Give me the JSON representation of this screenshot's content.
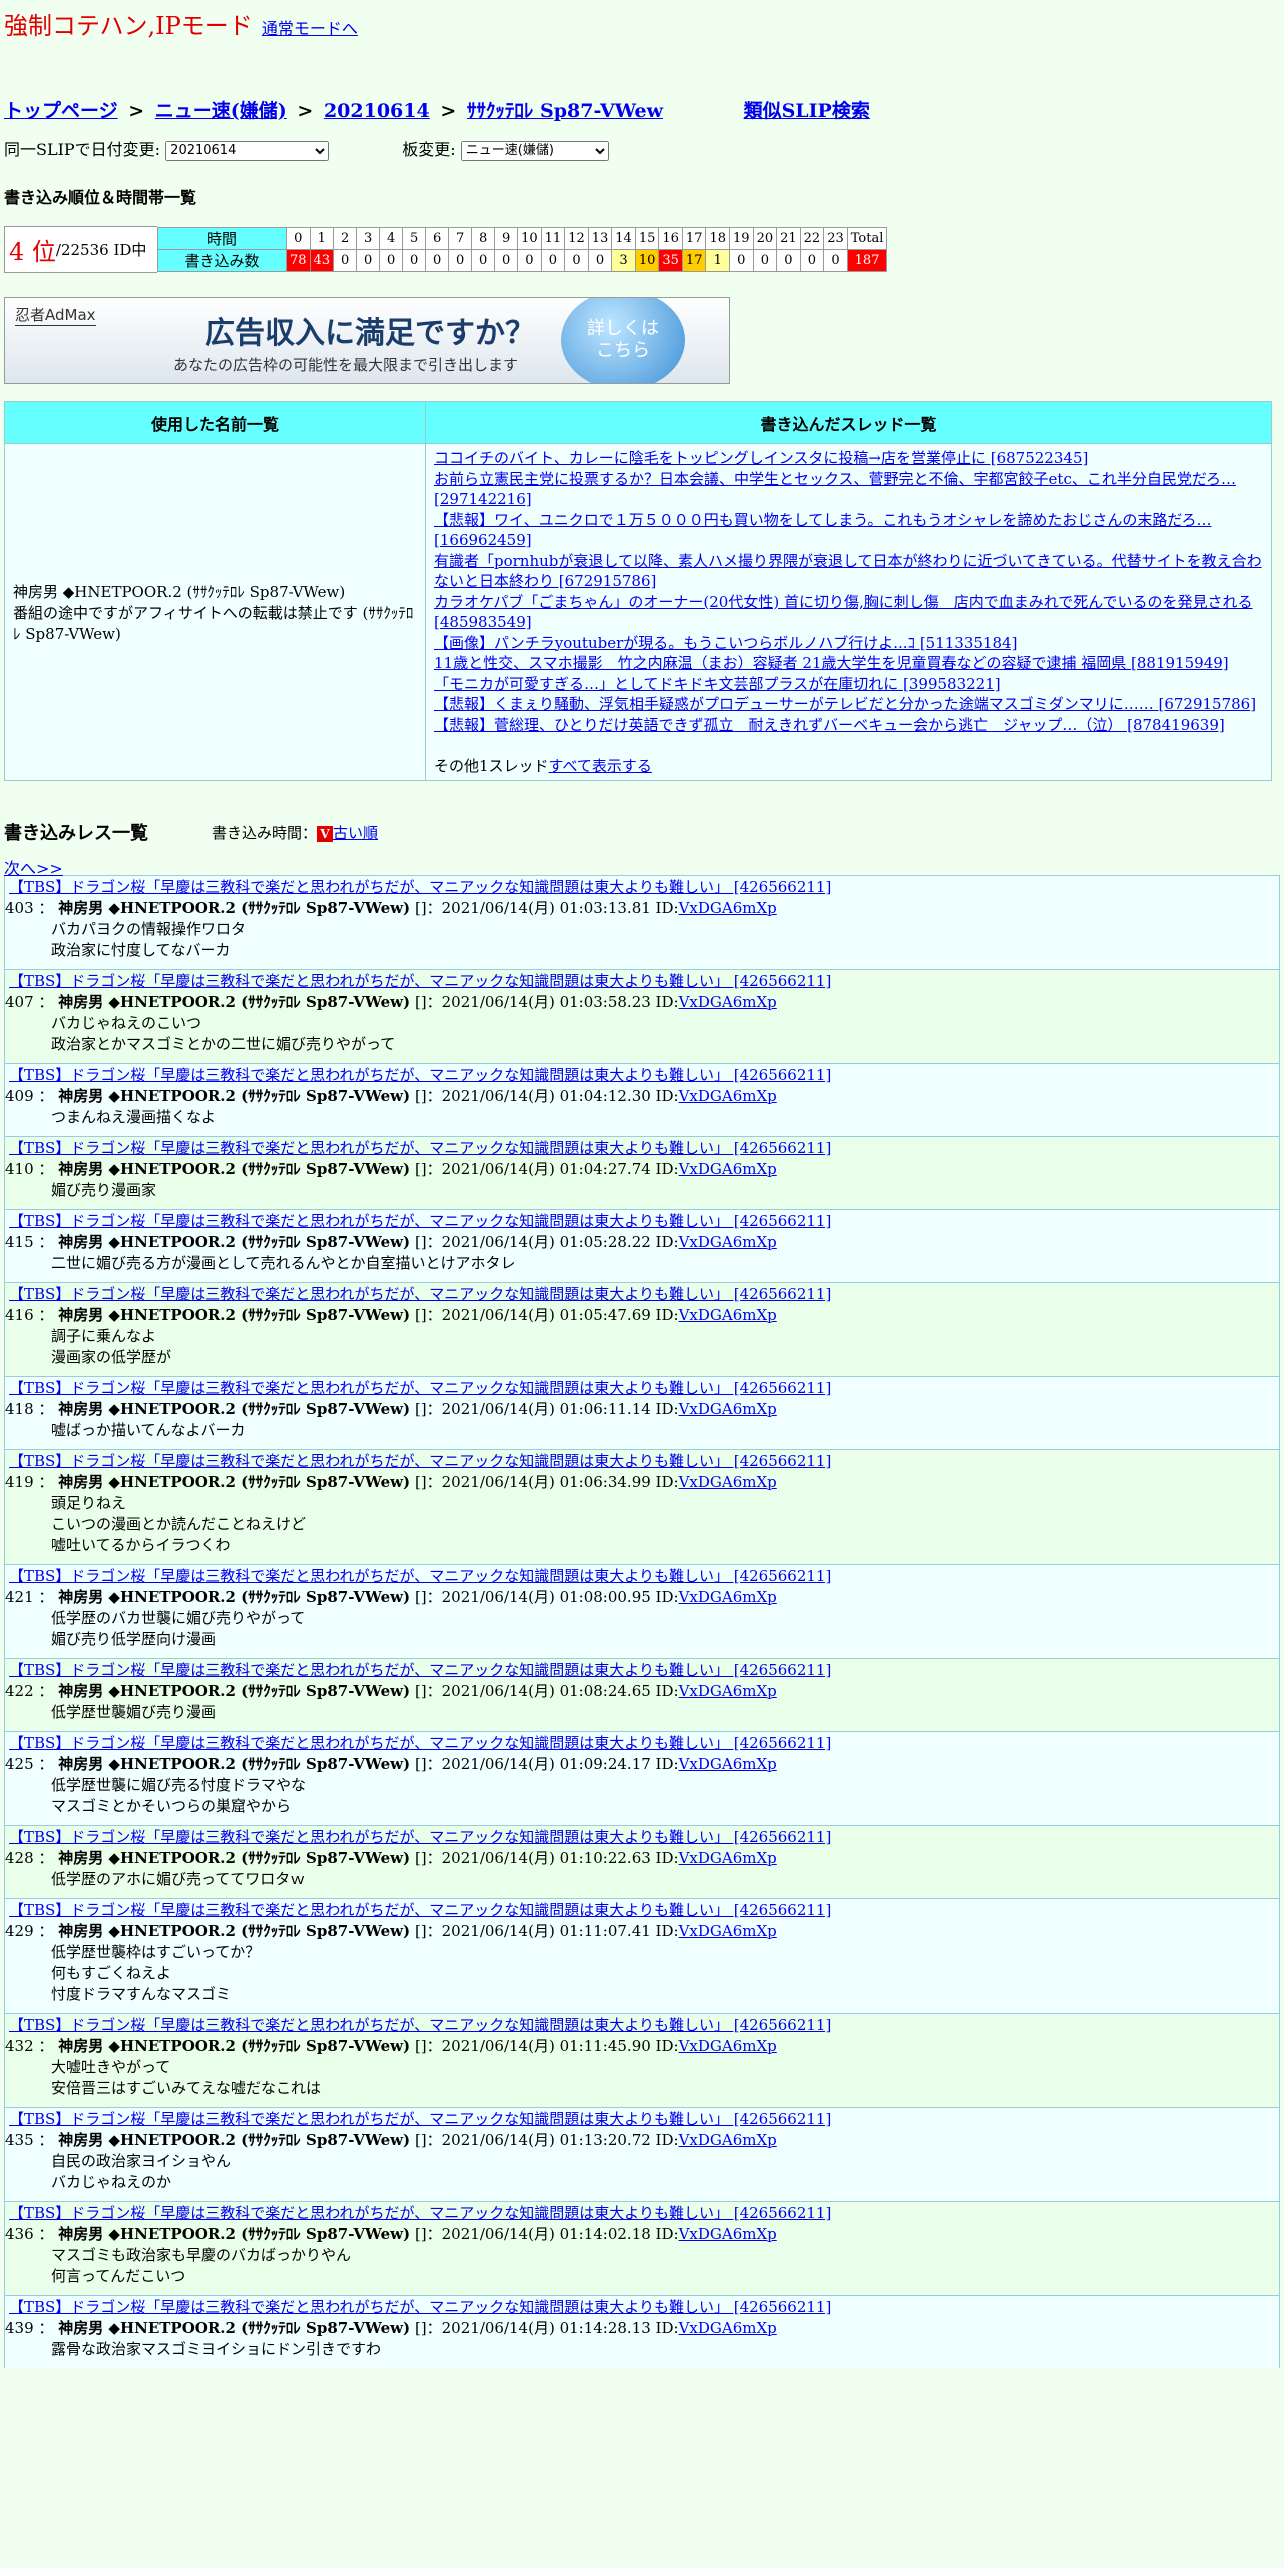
{
  "mode": {
    "title": "強制コテハン,IPモード",
    "link": "通常モードへ"
  },
  "breadcrumb": {
    "items": [
      "トップページ",
      "ニュー速(嫌儲)",
      "20210614",
      "ｻｻｸｯﾃﾛﾚ Sp87-VWew"
    ],
    "separator": ">",
    "similar": "類似SLIP検索"
  },
  "selects": {
    "date_label": "同一SLIPで日付変更:",
    "date_value": "20210614",
    "board_label": "板変更:",
    "board_value": "ニュー速(嫌儲)"
  },
  "rank": {
    "heading": "書き込み順位＆時間帯一覧",
    "position": "4 位",
    "of": "/22536 ID中",
    "time_label": "時間",
    "count_label": "書き込み数",
    "hours": [
      "0",
      "1",
      "2",
      "3",
      "4",
      "5",
      "6",
      "7",
      "8",
      "9",
      "10",
      "11",
      "12",
      "13",
      "14",
      "15",
      "16",
      "17",
      "18",
      "19",
      "20",
      "21",
      "22",
      "23",
      "Total"
    ],
    "counts": [
      "0",
      "78",
      "43",
      "0",
      "0",
      "0",
      "0",
      "0",
      "0",
      "0",
      "0",
      "0",
      "0",
      "0",
      "0",
      "3",
      "10",
      "35",
      "17",
      "1",
      "0",
      "0",
      "0",
      "0",
      "0",
      "187"
    ],
    "count_colors": [
      "",
      "red",
      "red",
      "",
      "",
      "",
      "",
      "",
      "",
      "",
      "",
      "",
      "",
      "",
      "",
      "lightyellow",
      "yellow",
      "red",
      "yellow",
      "lightyellow",
      "",
      "",
      "",
      "",
      "",
      "red"
    ]
  },
  "ad": {
    "brand": "忍者AdMax",
    "headline": "広告収入に満足ですか？",
    "sub": "あなたの広告枠の可能性を最大限まで引き出します",
    "button": "詳しくは\nこちら"
  },
  "names_table": {
    "col1": "使用した名前一覧",
    "col2": "書き込んだスレッド一覧",
    "names": [
      "神房男 ◆HNETPOOR.2 (ｻｻｸｯﾃﾛﾚ Sp87-VWew)",
      "番組の途中ですがアフィサイトへの転載は禁止です (ｻｻｸｯﾃﾛﾚ Sp87-VWew)"
    ],
    "threads": [
      "ココイチのバイト、カレーに陰毛をトッピングしインスタに投稿→店を営業停止に [687522345]",
      "お前ら立憲民主党に投票するか？日本会議、中学生とセックス、菅野完と不倫、宇都宮餃子etc、これ半分自民党だろ… [297142216]",
      "【悲報】ワイ、ユニクロで１万５０００円も買い物をしてしまう。これもうオシャレを諦めたおじさんの末路だろ… [166962459]",
      "有識者「pornhubが衰退して以降、素人ハメ撮り界隈が衰退して日本が終わりに近づいてきている。代替サイトを教え合わないと日本終わり [672915786]",
      "カラオケパブ「ごまちゃん」のオーナー(20代女性) 首に切り傷,胸に刺し傷　店内で血まみれで死んでいるのを発見される [485983549]",
      "【画像】パンチラyoutuberが現る。もうこいつらボルノハブ行けよ...ｺ [511335184]",
      "11歳と性交、スマホ撮影　竹之内麻温（まお）容疑者 21歳大学生を児童買春などの容疑で逮捕 福岡県 [881915949]",
      "「モニカが可愛すぎる…」としてドキドキ文芸部プラスが在庫切れに [399583221]",
      "【悲報】くまぇり騒動、浮気相手疑惑がプロデューサーがテレビだと分かった途端マスゴミダンマリに…… [672915786]",
      "【悲報】菅総理、ひとりだけ英語できず孤立　耐えきれずバーベキュー会から逃亡　ジャップ…（泣） [878419639]"
    ],
    "others_prefix": "その他1スレッド",
    "others_link": "すべて表示する"
  },
  "res": {
    "title": "書き込みレス一覧",
    "time_label": "書き込み時間：",
    "old_order": "古い順",
    "next": "次へ>>",
    "thread_title": "【TBS】ドラゴン桜「早慶は三教科で楽だと思われがちだが、マニアックな知識問題は東大よりも難しい」 [426566211]",
    "poster": "神房男 ◆HNETPOOR.2 (ｻｻｸｯﾃﾛﾚ Sp87-VWew)",
    "id": "VxDGA6mXp",
    "posts": [
      {
        "num": "403",
        "date": "[]：2021/06/14(月) 01:03:13.81 ID:",
        "lines": [
          "バカパヨクの情報操作ワロタ",
          "政治家に忖度してなバーカ"
        ]
      },
      {
        "num": "407",
        "date": "[]：2021/06/14(月) 01:03:58.23 ID:",
        "lines": [
          "バカじゃねえのこいつ",
          "政治家とかマスゴミとかの二世に媚び売りやがって"
        ]
      },
      {
        "num": "409",
        "date": "[]：2021/06/14(月) 01:04:12.30 ID:",
        "lines": [
          "つまんねえ漫画描くなよ"
        ]
      },
      {
        "num": "410",
        "date": "[]：2021/06/14(月) 01:04:27.74 ID:",
        "lines": [
          "媚び売り漫画家"
        ]
      },
      {
        "num": "415",
        "date": "[]：2021/06/14(月) 01:05:28.22 ID:",
        "lines": [
          "二世に媚び売る方が漫画として売れるんやとか自室描いとけアホタレ"
        ]
      },
      {
        "num": "416",
        "date": "[]：2021/06/14(月) 01:05:47.69 ID:",
        "lines": [
          "調子に乗んなよ",
          "漫画家の低学歴が"
        ]
      },
      {
        "num": "418",
        "date": "[]：2021/06/14(月) 01:06:11.14 ID:",
        "lines": [
          "嘘ばっか描いてんなよバーカ"
        ]
      },
      {
        "num": "419",
        "date": "[]：2021/06/14(月) 01:06:34.99 ID:",
        "lines": [
          "頭足りねえ",
          "こいつの漫画とか読んだことねえけど",
          "嘘吐いてるからイラつくわ"
        ]
      },
      {
        "num": "421",
        "date": "[]：2021/06/14(月) 01:08:00.95 ID:",
        "lines": [
          "低学歴のバカ世襲に媚び売りやがって",
          "媚び売り低学歴向け漫画"
        ]
      },
      {
        "num": "422",
        "date": "[]：2021/06/14(月) 01:08:24.65 ID:",
        "lines": [
          "低学歴世襲媚び売り漫画"
        ]
      },
      {
        "num": "425",
        "date": "[]：2021/06/14(月) 01:09:24.17 ID:",
        "lines": [
          "低学歴世襲に媚び売る忖度ドラマやな",
          "マスゴミとかそいつらの巣窟やから"
        ]
      },
      {
        "num": "428",
        "date": "[]：2021/06/14(月) 01:10:22.63 ID:",
        "lines": [
          "低学歴のアホに媚び売っててワロタｗ"
        ]
      },
      {
        "num": "429",
        "date": "[]：2021/06/14(月) 01:11:07.41 ID:",
        "lines": [
          "低学歴世襲枠はすごいってか？",
          "何もすごくねえよ",
          "忖度ドラマすんなマスゴミ"
        ]
      },
      {
        "num": "432",
        "date": "[]：2021/06/14(月) 01:11:45.90 ID:",
        "lines": [
          "大嘘吐きやがって",
          "安倍晋三はすごいみてえな嘘だなこれは"
        ]
      },
      {
        "num": "435",
        "date": "[]：2021/06/14(月) 01:13:20.72 ID:",
        "lines": [
          "自民の政治家ヨイショやん",
          "バカじゃねえのか"
        ]
      },
      {
        "num": "436",
        "date": "[]：2021/06/14(月) 01:14:02.18 ID:",
        "lines": [
          "マスゴミも政治家も早慶のバカばっかりやん",
          "何言ってんだこいつ"
        ]
      },
      {
        "num": "439",
        "date": "[]：2021/06/14(月) 01:14:28.13 ID:",
        "lines": [
          "露骨な政治家マスゴミヨイショにドン引きですわ"
        ]
      }
    ]
  }
}
